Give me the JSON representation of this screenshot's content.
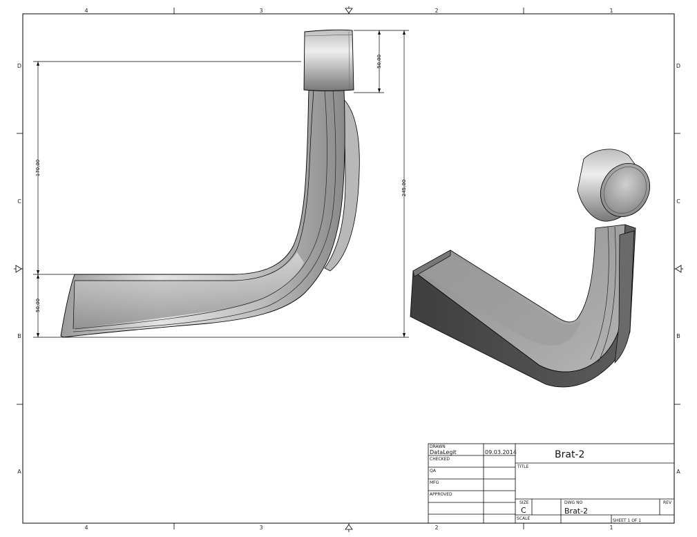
{
  "zones": {
    "top": [
      "4",
      "3",
      "2",
      "1"
    ],
    "bottom": [
      "4",
      "3",
      "2",
      "1"
    ],
    "left": [
      "D",
      "C",
      "B",
      "A"
    ],
    "right": [
      "D",
      "C",
      "B",
      "A"
    ]
  },
  "dimensions": {
    "top_height": "50,00",
    "upper_length": "170,00",
    "overall_height": "245,00",
    "bottom_height": "50,00"
  },
  "title_block": {
    "drawn_label": "DRAWN",
    "drawn_by": "DataLegit",
    "date": "09.03.2014",
    "checked_label": "CHECKED",
    "qa_label": "QA",
    "mfg_label": "MFG",
    "approved_label": "APPROVED",
    "part_name": "Brat-2",
    "title_label": "TITLE",
    "size_label": "SIZE",
    "size_value": "C",
    "dwg_no_label": "DWG NO",
    "dwg_no_value": "Brat-2",
    "rev_label": "REV",
    "scale_label": "SCALE",
    "sheet_label": "SHEET 1  OF 1"
  },
  "colors": {
    "part_light": "#c9c9c9",
    "part_dark": "#4a4a4a",
    "line": "#000000"
  }
}
